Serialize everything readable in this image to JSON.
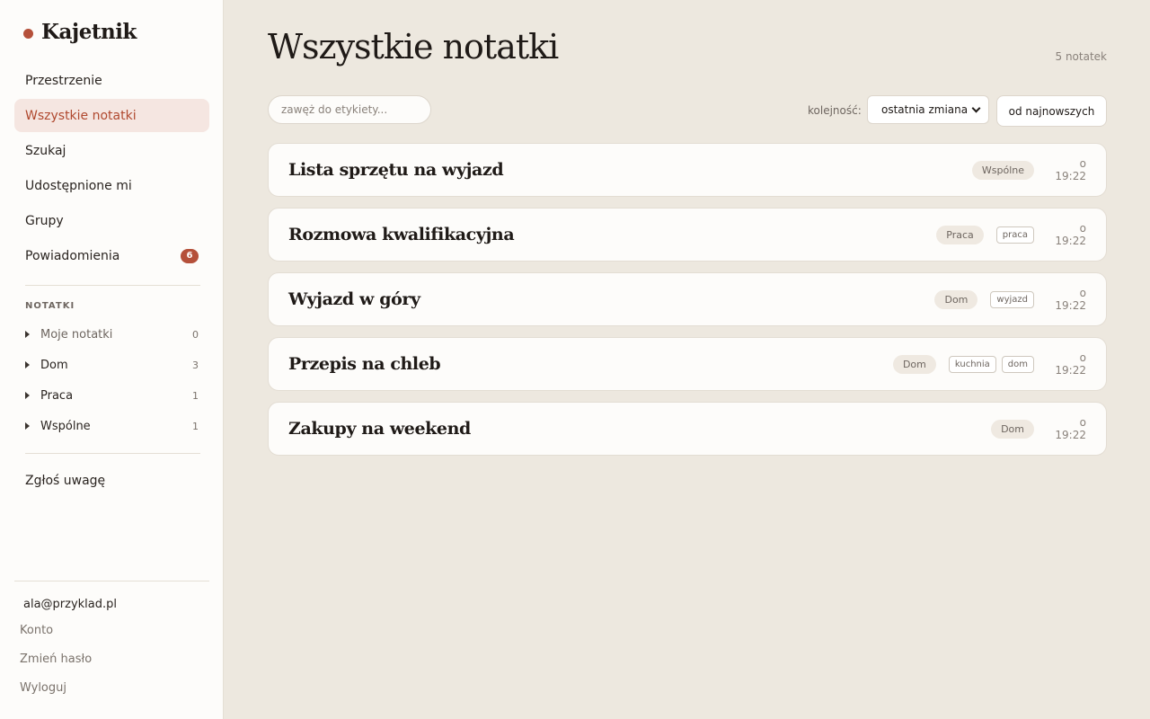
{
  "brand": {
    "name": "Kajetnik",
    "accent": "#b5503a"
  },
  "nav": [
    {
      "label": "Przestrzenie"
    },
    {
      "label": "Wszystkie notatki",
      "active": true
    },
    {
      "label": "Szukaj"
    },
    {
      "label": "Udostępnione mi"
    },
    {
      "label": "Grupy"
    },
    {
      "label": "Powiadomienia",
      "badge": "6"
    }
  ],
  "notebooks": {
    "section_label": "NOTATKI",
    "items": [
      {
        "label": "Moje notatki",
        "count": "0"
      },
      {
        "label": "Dom",
        "count": "3"
      },
      {
        "label": "Praca",
        "count": "1"
      },
      {
        "label": "Wspólne",
        "count": "1"
      }
    ]
  },
  "feedback_label": "Zgłoś uwagę",
  "account": {
    "email": "ala@przyklad.pl",
    "links": [
      "Konto",
      "Zmień hasło",
      "Wyloguj"
    ]
  },
  "main": {
    "title": "Wszystkie notatki",
    "count": "5 notatek",
    "filter_placeholder": "zawęż do etykiety...",
    "order_label": "kolejność:",
    "order_value": "ostatnia zmiana",
    "direction_label": "od najnowszych"
  },
  "notes": [
    {
      "title": "Lista sprzętu na wyjazd",
      "notebook": "Wspólne",
      "tags": [],
      "time": "o 19:22"
    },
    {
      "title": "Rozmowa kwalifikacyjna",
      "notebook": "Praca",
      "tags": [
        "praca"
      ],
      "time": "o 19:22"
    },
    {
      "title": "Wyjazd w góry",
      "notebook": "Dom",
      "tags": [
        "wyjazd"
      ],
      "time": "o 19:22"
    },
    {
      "title": "Przepis na chleb",
      "notebook": "Dom",
      "tags": [
        "kuchnia",
        "dom"
      ],
      "time": "o 19:22"
    },
    {
      "title": "Zakupy na weekend",
      "notebook": "Dom",
      "tags": [],
      "time": "o 19:22"
    }
  ]
}
